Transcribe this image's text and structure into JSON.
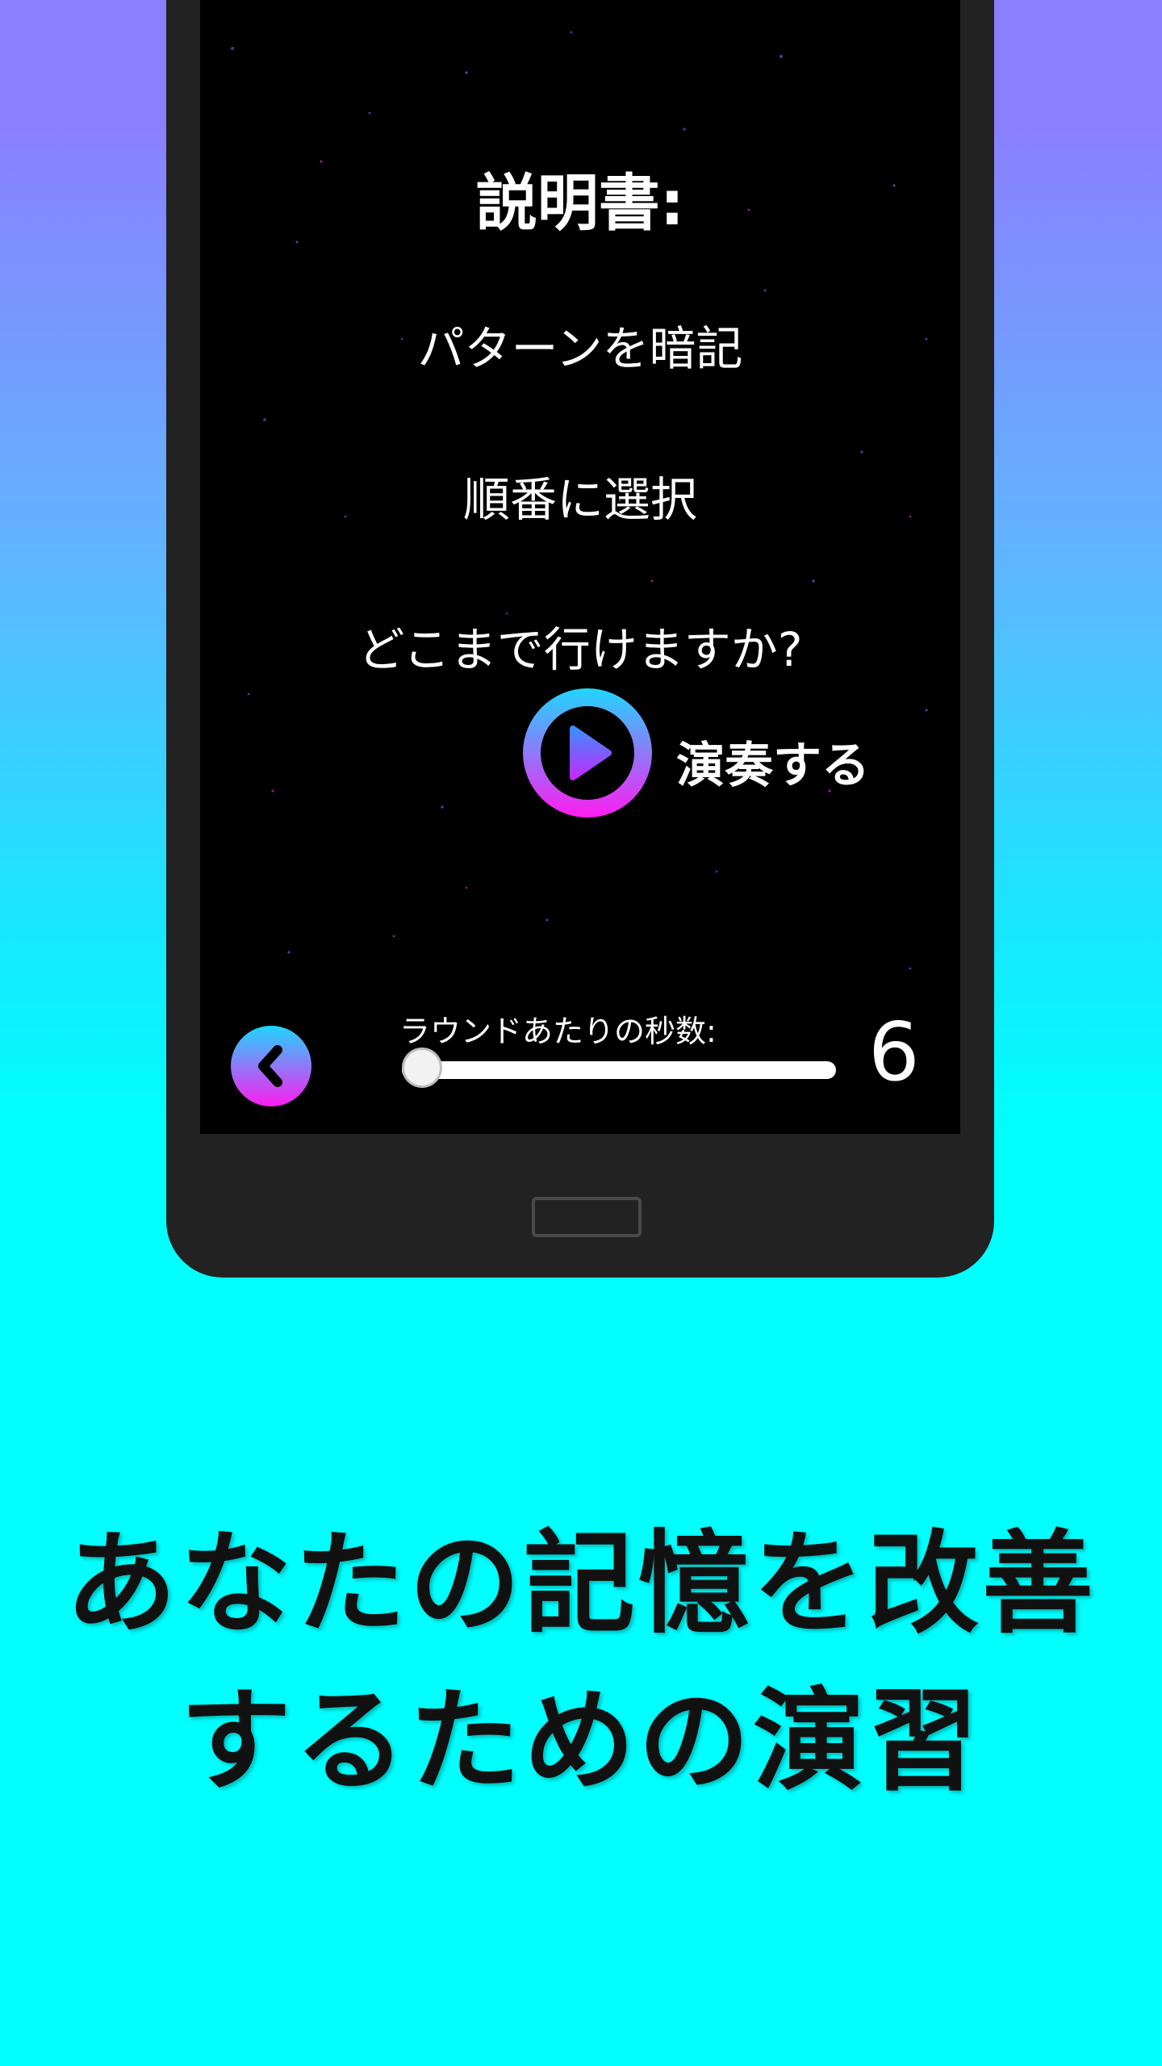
{
  "instructions": {
    "title": "説明書:",
    "lines": [
      "パターンを暗記",
      "順番に選択",
      "どこまで行けますか?"
    ]
  },
  "play": {
    "label": "演奏する"
  },
  "round_seconds": {
    "label": "ラウンドあたりの秒数:",
    "value": "6",
    "slider_fraction": 0
  },
  "promo": {
    "line1": "あなたの記憶を改善",
    "line2": "するための演習"
  },
  "colors": {
    "accent_cyan": "#1fd6ff",
    "accent_magenta": "#ff1cf0",
    "background_top": "#8a80ff",
    "background_bottom": "#00ffff"
  },
  "icons": {
    "play": "play-icon",
    "back": "chevron-left-icon"
  }
}
